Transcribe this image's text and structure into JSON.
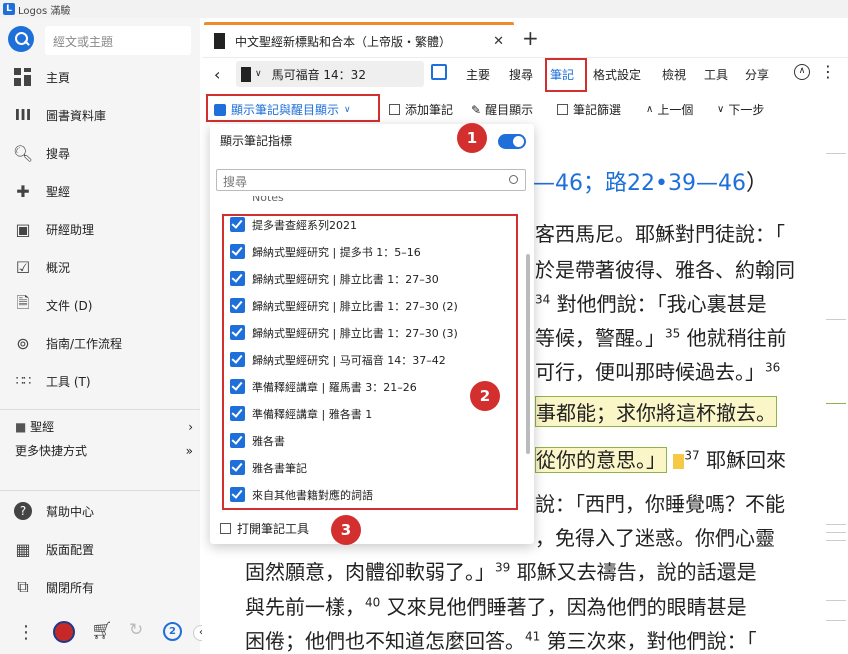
{
  "app": {
    "title": "Logos 滿驗"
  },
  "sidebar": {
    "search_placeholder": "經文或主題",
    "items": [
      {
        "label": "主頁",
        "icon": "dashboard-icon"
      },
      {
        "label": "圖書資料庫",
        "icon": "library-icon"
      },
      {
        "label": "搜尋",
        "icon": "search-icon"
      },
      {
        "label": "聖經",
        "icon": "bible-icon"
      },
      {
        "label": "研經助理",
        "icon": "study-assistant-icon"
      },
      {
        "label": "概況",
        "icon": "overview-icon"
      },
      {
        "label": "文件 (D)",
        "icon": "documents-icon"
      },
      {
        "label": "指南/工作流程",
        "icon": "guides-icon"
      },
      {
        "label": "工具 (T)",
        "icon": "tools-icon"
      }
    ],
    "shortcut": "聖經",
    "more_shortcuts": "更多快捷方式",
    "bottom_items": [
      {
        "label": "幫助中心",
        "icon": "help-icon"
      },
      {
        "label": "版面配置",
        "icon": "layout-icon"
      },
      {
        "label": "關閉所有",
        "icon": "close-all-icon"
      }
    ]
  },
  "tab": {
    "title": "中文聖經新標點和合本（上帝版・繁體）"
  },
  "toolbar": {
    "reference": "馬可福音 14：32",
    "menu": [
      "主要",
      "搜尋",
      "筆記",
      "格式設定",
      "檢視",
      "工具",
      "分享"
    ],
    "notes_toggle": "顯示筆記與醒目顯示",
    "add_note": "添加筆記",
    "highlight": "醒目顯示",
    "note_filter": "筆記篩選",
    "prev": "上一個",
    "next": "下一步"
  },
  "dropdown": {
    "header": "顯示筆記指標",
    "search_placeholder": "搜尋",
    "partial_top": "Notes",
    "items": [
      "提多書查經系列2021",
      "歸納式聖經研究 | 提多书 1：5–16",
      "歸納式聖經研究 | 腓立比書 1：27–30",
      "歸納式聖經研究 | 腓立比書 1：27–30 (2)",
      "歸納式聖經研究 | 腓立比書 1：27–30 (3)",
      "歸納式聖經研究 | 马可福音 14：37–42",
      "準備釋經講章 | 羅馬書 3：21–26",
      "準備釋經講章 | 雅各書 1",
      "雅各書",
      "雅各書筆記",
      "來自其他書籍對應的詞語"
    ],
    "footer": "打開筆記工具"
  },
  "badges": [
    "1",
    "2",
    "3"
  ],
  "bible": {
    "l1a": "—46；",
    "l1b": "路22•39—46",
    "l1c": "）",
    "l2": "客西馬尼。耶穌對門徒說：「",
    "l3": "於是帶著彼得、雅各、約翰同",
    "l4a": "34",
    "l4b": " 對他們說：「我心裏甚是",
    "l5": "等候，警醒。」",
    "l5s": "35",
    "l5b": " 他就稍往前",
    "l6": "可行，便叫那時候過去。」",
    "l6s": "36",
    "l7": "事都能；求你將這杯撤去。",
    "l8": "從你的意思。」",
    "l8s": "37",
    "l8b": " 耶穌回來",
    "l9": "說：「西門，你睡覺嗎？不能",
    "l10": "，免得入了迷惑。你們心靈",
    "l11": "固然願意，肉體卻軟弱了。」",
    "l11s": "39",
    "l11b": " 耶穌又去禱告，說的話還是",
    "l12": "與先前一樣，",
    "l12s": "40",
    "l12b": " 又來見他們睡著了，因為他們的眼睛甚是",
    "l13": "困倦；他們也不知道怎麼回答。",
    "l13s": "41",
    "l13b": " 第三次來，對他們說：「"
  },
  "colors": {
    "accent": "#1e6fd9",
    "callout": "#d32f2f",
    "tab_top": "#f08a2b",
    "highlight": "#fbf6c8"
  }
}
